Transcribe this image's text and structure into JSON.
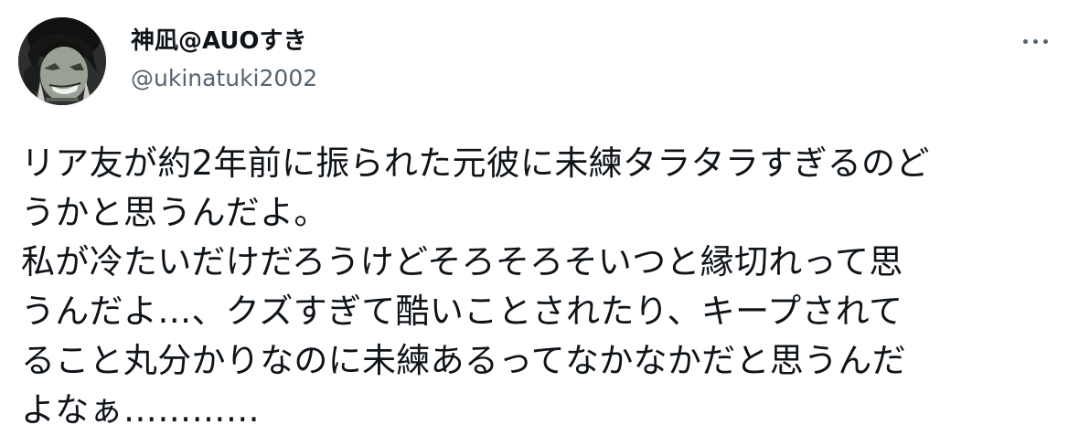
{
  "author": {
    "display_name": "神凪@AUOすき",
    "handle": "@ukinatuki2002",
    "avatar": "avatar-image"
  },
  "actions": {
    "more_icon": "more-horizontal-icon"
  },
  "tweet": {
    "lines": [
      "リア友が約2年前に振られた元彼に未練タラタラすぎるのど",
      "うかと思うんだよ。",
      "私が冷たいだけだろうけどそろそろそいつと縁切れって思",
      "うんだよ…、クズすぎて酷いことされたり、キープされて",
      "ること丸分かりなのに未練あるってなかなかだと思うんだ",
      "よなぁ…………"
    ]
  },
  "colors": {
    "text_primary": "#0f1419",
    "text_secondary": "#536471",
    "background": "#ffffff"
  }
}
